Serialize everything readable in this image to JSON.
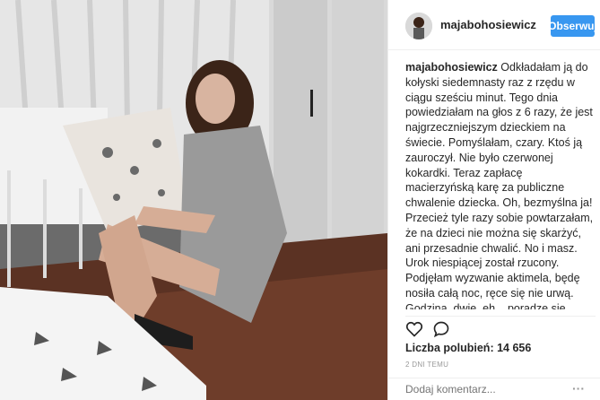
{
  "post": {
    "username": "majabohosiewicz",
    "follow_label": "Obserwuj",
    "caption_user": "majabohosiewicz",
    "caption_text": " Odkładałam ją do kołyski siedemnasty raz z rzędu w ciągu sześciu minut. Tego dnia powiedziałam na głos z 6 razy, że jest najgrzeczniejszym dzieckiem na świecie. Pomyślałam, czary. Ktoś ją zauroczył. Nie było czerwonej kokardki. Teraz zapłacę macierzyńską karę za publiczne chwalenie dziecka. Oh, bezmyślna ja! Przecież tyle razy sobie powtarzałam, że na dzieci nie można się skarżyć, ani przesadnie chwalić. No i masz. Urok niespiącej został rzucony. Podjęłam wyzwanie aktimela, będę nosiła całą noc, ręce się nie urwą. Godzina, dwie, eh... poradzę się Instamatek. No i doszłam do końca internetów. Do miejsca gdzie zaczyna się tęcza i gdzie siedzi krasnal ze złotymi dukatami. Internety powiedziały, że wg. Babć dziecko trzeba polizać po czole. Trzy razy. I splunąć. Przez lewe ramię. Co mam",
    "likes_text": "Liczba polubień: 14 656",
    "time_text": "2 DNI TEMU",
    "comment_placeholder": "Dodaj komentarz...",
    "more_label": "···"
  },
  "icons": {
    "like": "heart-icon",
    "comment": "comment-icon",
    "options": "more-options-icon"
  },
  "colors": {
    "accent": "#3897f0",
    "text": "#262626",
    "muted": "#999999"
  }
}
